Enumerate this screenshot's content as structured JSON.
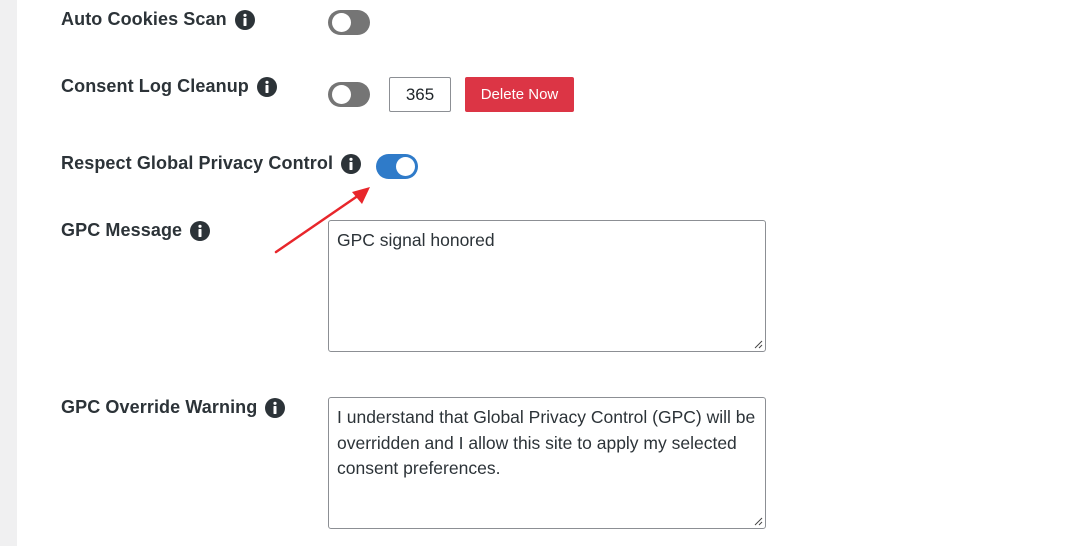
{
  "settings": {
    "auto_cookies_scan": {
      "label": "Auto Cookies Scan",
      "enabled": false
    },
    "consent_log_cleanup": {
      "label": "Consent Log Cleanup",
      "enabled": false,
      "days_value": "365",
      "delete_button_label": "Delete Now"
    },
    "respect_gpc": {
      "label": "Respect Global Privacy Control",
      "enabled": true
    },
    "gpc_message": {
      "label": "GPC Message",
      "value": "GPC signal honored"
    },
    "gpc_override_warning": {
      "label": "GPC Override Warning",
      "value": "I understand that Global Privacy Control (GPC) will be overridden and I allow this site to apply my selected consent preferences."
    }
  },
  "icons": {
    "info": "info-circle-icon",
    "annotation": "red-arrow"
  },
  "colors": {
    "toggle_on": "#2f7bc9",
    "toggle_off": "#757575",
    "delete_button": "#dc3545",
    "annotation_arrow": "#e8262b"
  }
}
